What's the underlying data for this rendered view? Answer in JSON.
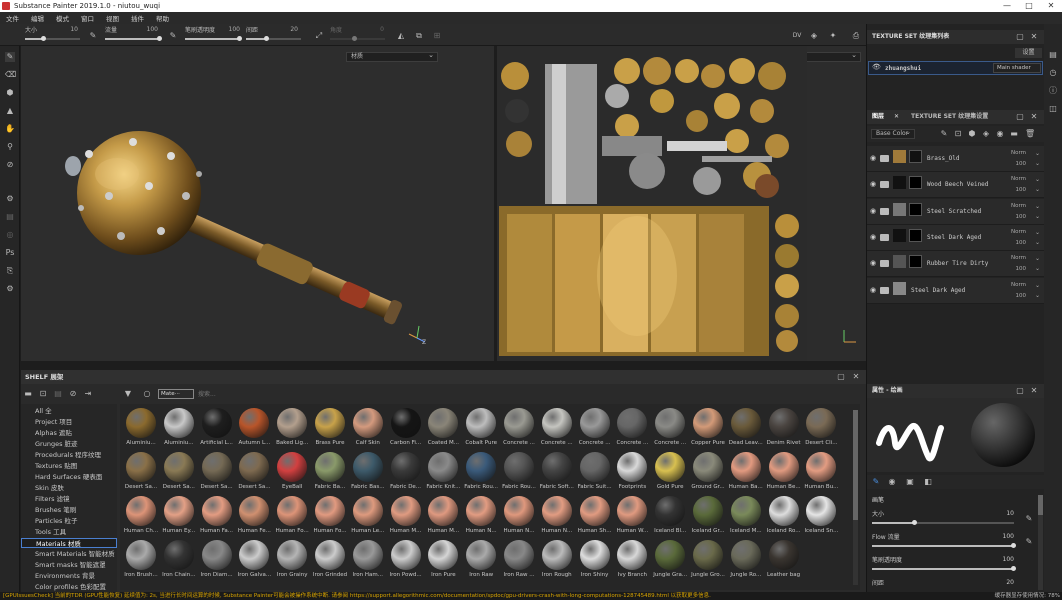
{
  "titlebar": {
    "title": "Substance Painter 2019.1.0 - niutou_wuqi",
    "minimize": "—",
    "maximize": "□",
    "close": "✕"
  },
  "menu": [
    "文件",
    "编辑",
    "模式",
    "窗口",
    "视图",
    "插件",
    "帮助"
  ],
  "toolbar": {
    "size_label": "大小",
    "size_value": "10",
    "flow_label": "流量",
    "flow_value": "100",
    "stroke_opacity_label": "笔刷透明度",
    "stroke_opacity_value": "100",
    "spacing_label": "间距",
    "spacing_value": "20",
    "angle_label": "角度",
    "angle_value": "0",
    "view_mode": "DV"
  },
  "viewport3d": {
    "dropdown": "材质"
  },
  "viewport2d": {
    "dropdown": "材质"
  },
  "texture_set_list": {
    "title": "TEXTURE SET 纹理集列表",
    "settings_label": "设置",
    "item_name": "zhuangshui",
    "shader": "Main shader"
  },
  "layers_panel": {
    "tab_layers": "图层",
    "tab_settings": "TEXTURE SET 纹理集设置",
    "channel": "Base Color",
    "layers": [
      {
        "name": "Brass_Old",
        "blend": "Norm",
        "opacity": "100",
        "thumb": "#a07a3a",
        "mask": "#111"
      },
      {
        "name": "Wood Beech Veined",
        "blend": "Norm",
        "opacity": "100",
        "thumb": "#111",
        "mask": "#000"
      },
      {
        "name": "Steel Scratched",
        "blend": "Norm",
        "opacity": "100",
        "thumb": "#777",
        "mask": "#000"
      },
      {
        "name": "Steel Dark Aged",
        "blend": "Norm",
        "opacity": "100",
        "thumb": "#111",
        "mask": "#000"
      },
      {
        "name": "Rubber Tire Dirty",
        "blend": "Norm",
        "opacity": "100",
        "thumb": "#555",
        "mask": "#000"
      },
      {
        "name": "Steel Dark Aged",
        "blend": "Norm",
        "opacity": "100",
        "thumb": "#888",
        "mask": ""
      }
    ]
  },
  "properties": {
    "title": "属性 - 绘画",
    "section": "画笔",
    "size_label": "大小",
    "size_value": "10",
    "flow_label": "Flow 流量",
    "flow_value": "100",
    "opacity_label": "笔刷透明度",
    "opacity_value": "100",
    "spacing_label": "间距",
    "spacing_value": "20"
  },
  "shelf": {
    "title": "SHELF 展架",
    "filter_tag": "Mate···",
    "search_placeholder": "搜索...",
    "categories": [
      "All 全",
      "Project 项目",
      "Alphas 遮贴",
      "Grunges 脏迹",
      "Procedurals 程序纹理",
      "Textures 贴图",
      "Hard Surfaces 硬表面",
      "Skin 皮肤",
      "Filters 滤镜",
      "Brushes 笔刷",
      "Particles 粒子",
      "Tools 工具",
      "Materials 材质",
      "Smart Materials 智能材质",
      "Smart masks 智能遮罩",
      "Environments 背景",
      "Color profiles 色彩配置"
    ],
    "selected_category": 12,
    "materials": [
      [
        "Aluminiu...",
        "#8b6a2e"
      ],
      [
        "Aluminiu...",
        "#c8c8c8"
      ],
      [
        "Artificial L...",
        "#1e1e1e"
      ],
      [
        "Autumn L...",
        "#b9552a"
      ],
      [
        "Baked Lig...",
        "#b39f8d"
      ],
      [
        "Brass Pure",
        "#c8a24a"
      ],
      [
        "Calf Skin",
        "#d49a7e"
      ],
      [
        "Carbon Fi...",
        "#151515"
      ],
      [
        "Coated M...",
        "#8a8578"
      ],
      [
        "Cobalt Pure",
        "#bdbdbd"
      ],
      [
        "Concrete ...",
        "#9a9a92"
      ],
      [
        "Concrete ...",
        "#c5c5c0"
      ],
      [
        "Concrete ...",
        "#999"
      ],
      [
        "Concrete ...",
        "#666"
      ],
      [
        "Concrete ...",
        "#8a8a86"
      ],
      [
        "Copper Pure",
        "#d39a78"
      ],
      [
        "Dead Leav...",
        "#6a5a3a"
      ],
      [
        "Denim Rivet",
        "#4a4440"
      ],
      [
        "Desert Cli...",
        "#7a6a55"
      ],
      [
        "Desert Sa...",
        "#8a7048"
      ],
      [
        "Desert Sa...",
        "#8a7a55"
      ],
      [
        "Desert Sa...",
        "#756a55"
      ],
      [
        "Desert Sa...",
        "#7e6a50"
      ],
      [
        "EyeBall",
        "#d24040"
      ],
      [
        "Fabric Ba...",
        "#8a9a6a"
      ],
      [
        "Fabric Bas...",
        "#3d5a6a"
      ],
      [
        "Fabric De...",
        "#3a3a3a"
      ],
      [
        "Fabric Knit...",
        "#8a8a8a"
      ],
      [
        "Fabric Rou...",
        "#3a5a7a"
      ],
      [
        "Fabric Rou...",
        "#555"
      ],
      [
        "Fabric Soft...",
        "#444"
      ],
      [
        "Fabric Suit...",
        "#666"
      ],
      [
        "Footprints",
        "#d9d9d9"
      ],
      [
        "Gold Pure",
        "#d8c050"
      ],
      [
        "Ground Gr...",
        "#8a8a7a"
      ],
      [
        "Human Ba...",
        "#e29a80"
      ],
      [
        "Human Be...",
        "#e09a80"
      ],
      [
        "Human Bu...",
        "#e39c82"
      ],
      [
        "Human Ch...",
        "#dd9478"
      ],
      [
        "Human Ey...",
        "#e3a086"
      ],
      [
        "Human Fa...",
        "#e39c82"
      ],
      [
        "Human Fe...",
        "#d09070"
      ],
      [
        "Human Fo...",
        "#dd9478"
      ],
      [
        "Human Fo...",
        "#e19a80"
      ],
      [
        "Human Le...",
        "#de9a7e"
      ],
      [
        "Human M...",
        "#e09b81"
      ],
      [
        "Human M...",
        "#df9980"
      ],
      [
        "Human N...",
        "#e29c82"
      ],
      [
        "Human N...",
        "#df987d"
      ],
      [
        "Human N...",
        "#e29c82"
      ],
      [
        "Human Sh...",
        "#e19b81"
      ],
      [
        "Human W...",
        "#e09a80"
      ],
      [
        "Iceland Bl...",
        "#333"
      ],
      [
        "Iceland Gr...",
        "#5a6a3a"
      ],
      [
        "Iceland M...",
        "#7a8a5a"
      ],
      [
        "Iceland Ro...",
        "#ddd"
      ],
      [
        "Iceland Sn...",
        "#e5e5e5"
      ],
      [
        "Iron Brush...",
        "#aaa"
      ],
      [
        "Iron Chain...",
        "#333"
      ],
      [
        "Iron Diam...",
        "#888"
      ],
      [
        "Iron Galva...",
        "#ccc"
      ],
      [
        "Iron Grainy",
        "#b5b5b5"
      ],
      [
        "Iron Grinded",
        "#ccc"
      ],
      [
        "Iron Ham...",
        "#999"
      ],
      [
        "Iron Powd...",
        "#ccc"
      ],
      [
        "Iron Pure",
        "#d5d5d5"
      ],
      [
        "Iron Raw",
        "#aaa"
      ],
      [
        "Iron Raw ...",
        "#888"
      ],
      [
        "Iron Rough",
        "#bbb"
      ],
      [
        "Iron Shiny",
        "#ddd"
      ],
      [
        "Ivy Branch",
        "#d8d8d8"
      ],
      [
        "Jungle Gra...",
        "#5a6a3a"
      ],
      [
        "Jungle Gro...",
        "#6a6a4a"
      ],
      [
        "Jungle Ro...",
        "#6a6a5a"
      ],
      [
        "Leather bag",
        "#3a3530"
      ]
    ]
  },
  "statusbar": {
    "message": "[GPUIssuesCheck] 当前的TDR (GPU性能恢复) 延续值为: 2s, 当进行长时间运算的时候, Substance Painter可能会被操作系统中断. 请参阅 https://support.allegorithmic.com/documentation/spdoc/gpu-drivers-crash-with-long-computations-128745489.html 以获取更多信息.",
    "vram_label": "缓存器显存使用情况:",
    "vram_value": "78%"
  }
}
